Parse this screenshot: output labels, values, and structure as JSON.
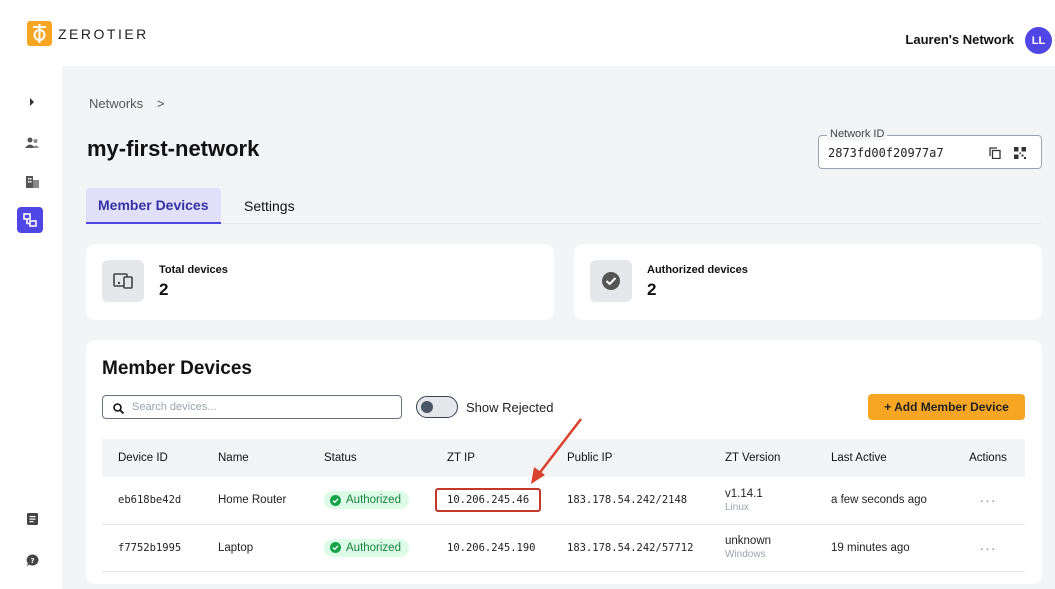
{
  "app": {
    "logo_text": "ZEROTIER",
    "network_selector": "Lauren's Network",
    "avatar_initials": "LL",
    "brand_color": "#f6a623",
    "accent_color": "#4f46e5"
  },
  "sidebar": {
    "icons": [
      "expand-chevron-icon",
      "users-icon",
      "organization-icon",
      "networks-icon",
      "docs-icon",
      "help-icon"
    ],
    "active": "networks-icon"
  },
  "breadcrumb": {
    "item": "Networks",
    "separator": ">"
  },
  "page": {
    "title": "my-first-network",
    "network_id_label": "Network ID",
    "network_id": "2873fd00f20977a7"
  },
  "tabs": [
    {
      "label": "Member Devices",
      "active": true
    },
    {
      "label": "Settings",
      "active": false
    }
  ],
  "stats": {
    "total": {
      "label": "Total devices",
      "value": "2"
    },
    "authorized": {
      "label": "Authorized devices",
      "value": "2"
    }
  },
  "members": {
    "title": "Member Devices",
    "search_placeholder": "Search devices...",
    "toggle_label": "Show Rejected",
    "add_button": "+ Add Member Device",
    "columns": [
      "Device ID",
      "Name",
      "Status",
      "ZT IP",
      "Public IP",
      "ZT Version",
      "Last Active",
      "Actions"
    ],
    "rows": [
      {
        "device_id": "eb618be42d",
        "name": "Home Router",
        "status": "Authorized",
        "zt_ip": "10.206.245.46",
        "public_ip": "183.178.54.242/2148",
        "version": "v1.14.1",
        "os": "Linux",
        "last_active": "a few seconds ago",
        "actions": "···"
      },
      {
        "device_id": "f7752b1995",
        "name": "Laptop",
        "status": "Authorized",
        "zt_ip": "10.206.245.190",
        "public_ip": "183.178.54.242/57712",
        "version": "unknown",
        "os": "Windows",
        "last_active": "19 minutes ago",
        "actions": "···"
      }
    ]
  }
}
